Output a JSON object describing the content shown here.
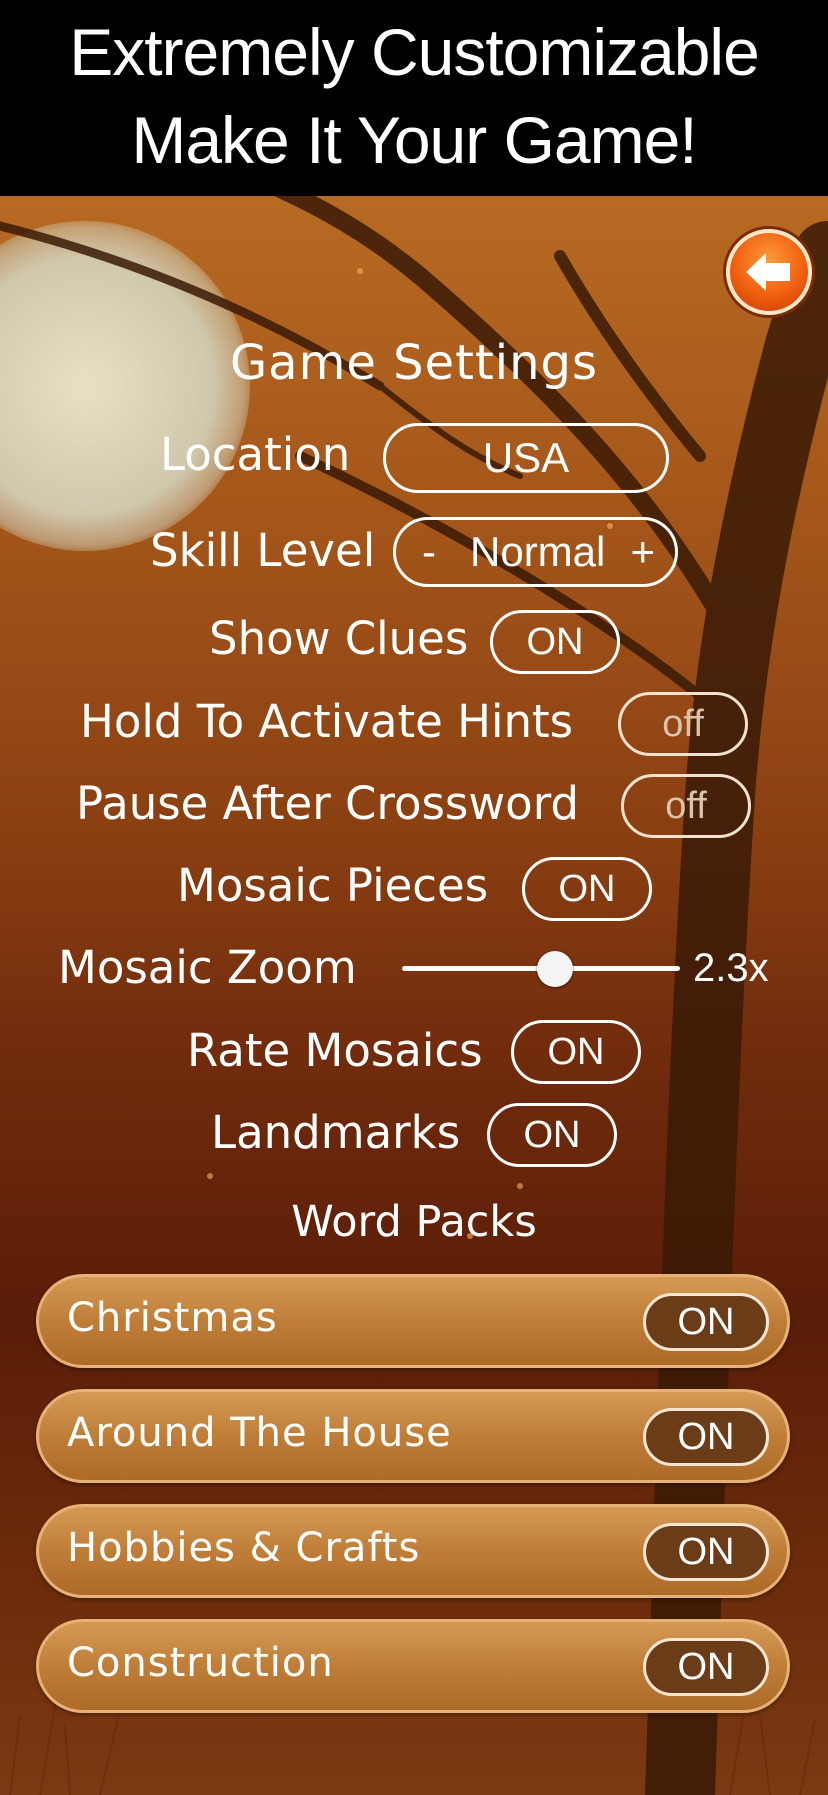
{
  "banner": {
    "line1": "Extremely Customizable",
    "line2": "Make It Your Game!"
  },
  "header": {
    "title": "Game Settings",
    "back_icon": "back-arrow-icon"
  },
  "settings": {
    "location": {
      "label": "Location",
      "value": "USA"
    },
    "skill_level": {
      "label": "Skill Level",
      "minus": "-",
      "value": "Normal",
      "plus": "+"
    },
    "show_clues": {
      "label": "Show Clues",
      "value": "ON"
    },
    "hold_hints": {
      "label": "Hold To Activate Hints",
      "value": "off"
    },
    "pause_after": {
      "label": "Pause After Crossword",
      "value": "off"
    },
    "mosaic_pieces": {
      "label": "Mosaic Pieces",
      "value": "ON"
    },
    "mosaic_zoom": {
      "label": "Mosaic Zoom",
      "value": "2.3x",
      "slider_fraction": 0.55
    },
    "rate_mosaics": {
      "label": "Rate Mosaics",
      "value": "ON"
    },
    "landmarks": {
      "label": "Landmarks",
      "value": "ON"
    }
  },
  "word_packs": {
    "title": "Word Packs",
    "items": [
      {
        "label": "Christmas",
        "value": "ON"
      },
      {
        "label": "Around The House",
        "value": "ON"
      },
      {
        "label": "Hobbies & Crafts",
        "value": "ON"
      },
      {
        "label": "Construction",
        "value": "ON"
      }
    ]
  },
  "colors": {
    "accent_orange": "#f06010",
    "pack_gold": "#bf7e38",
    "toggle_dark": "#6a3c18"
  }
}
